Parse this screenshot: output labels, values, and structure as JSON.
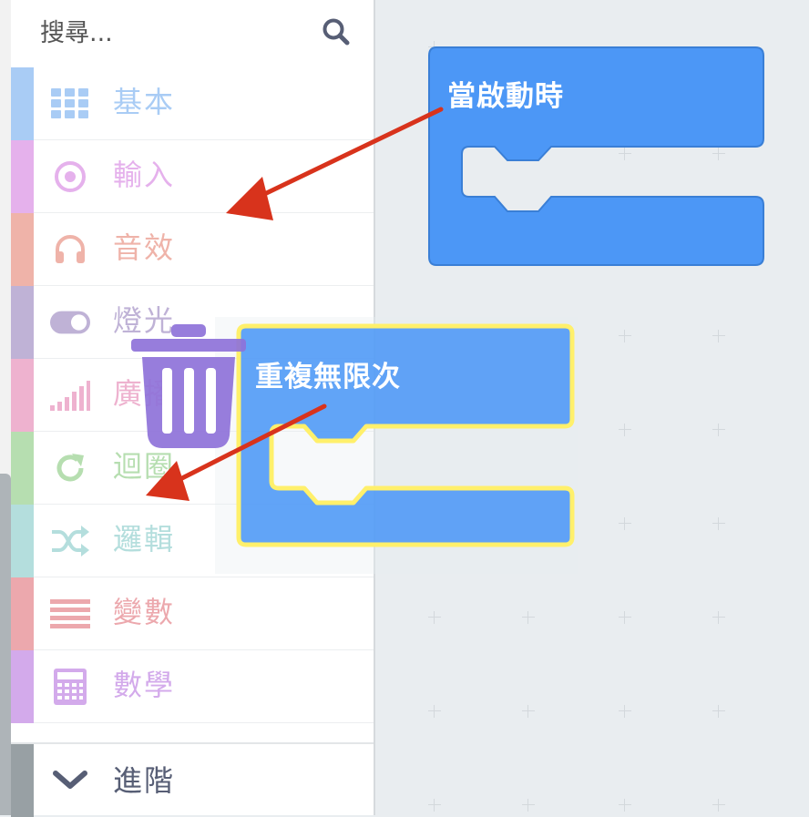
{
  "search": {
    "placeholder": "搜尋..."
  },
  "categories": [
    {
      "label": "基本",
      "color": "#a9ccf5",
      "icon": "grid-icon"
    },
    {
      "label": "輸入",
      "color": "#e5b1ec",
      "icon": "radio-target-icon"
    },
    {
      "label": "音效",
      "color": "#efb3a9",
      "icon": "headphones-icon"
    },
    {
      "label": "燈光",
      "color": "#bfb2d6",
      "icon": "toggle-icon"
    },
    {
      "label": "廣播",
      "color": "#eeb2cf",
      "icon": "signal-bars-icon"
    },
    {
      "label": "迴圈",
      "color": "#b6deb0",
      "icon": "refresh-icon"
    },
    {
      "label": "邏輯",
      "color": "#b4dedd",
      "icon": "shuffle-icon"
    },
    {
      "label": "變數",
      "color": "#eca8ad",
      "icon": "list-lines-icon"
    },
    {
      "label": "數學",
      "color": "#d3aaeb",
      "icon": "calculator-icon"
    }
  ],
  "advanced": {
    "label": "進階",
    "icon": "chevron-down-icon"
  },
  "workspace_blocks": {
    "on_start": {
      "label": "當啟動時",
      "color": "#4c97f6"
    },
    "forever": {
      "label": "重複無限次",
      "color": "#4c97f6",
      "highlight": "#fff06b"
    }
  },
  "trash": {
    "icon": "trash-icon",
    "color": "#8e72d9"
  },
  "annotations": {
    "arrow_color": "#d8331c"
  }
}
